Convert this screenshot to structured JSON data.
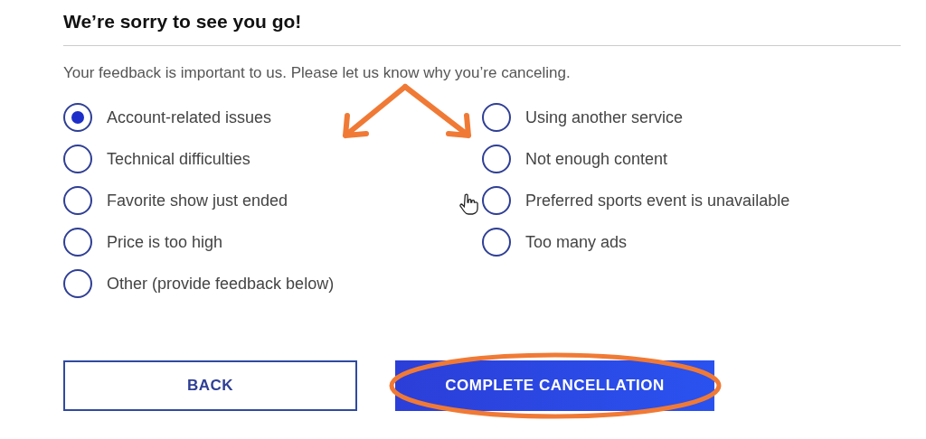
{
  "heading": "We’re sorry to see you go!",
  "message": "Your feedback is important to us. Please let us know why you’re canceling.",
  "reasons": [
    [
      {
        "label": "Account-related issues",
        "selected": true
      },
      {
        "label": "Technical difficulties",
        "selected": false
      },
      {
        "label": "Favorite show just ended",
        "selected": false
      },
      {
        "label": "Price is too high",
        "selected": false
      },
      {
        "label": "Other (provide feedback below)",
        "selected": false
      }
    ],
    [
      {
        "label": "Using another service",
        "selected": false
      },
      {
        "label": "Not enough content",
        "selected": false
      },
      {
        "label": "Preferred sports event is unavailable",
        "selected": false
      },
      {
        "label": "Too many ads",
        "selected": false
      }
    ]
  ],
  "buttons": [
    {
      "label": "BACK",
      "kind": "secondary"
    },
    {
      "label": "COMPLETE CANCELLATION",
      "kind": "primary"
    }
  ]
}
